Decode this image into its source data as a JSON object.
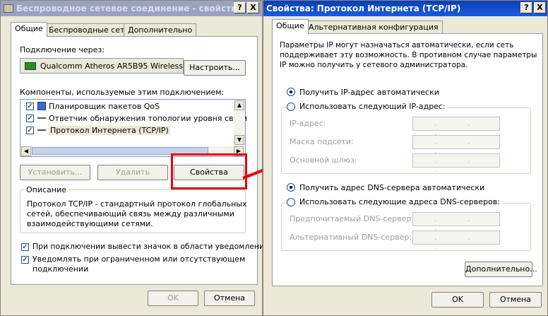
{
  "left_dialog": {
    "title": "Беспроводное сетевое соединение - свойства",
    "help_btn": "?",
    "close_btn": "X",
    "tabs": [
      "Общие",
      "Беспроводные сети",
      "Дополнительно"
    ],
    "connect_through_label": "Подключение через:",
    "adapter_name": "Qualcomm Atheros AR5B95 Wireless",
    "configure_btn": "Настроить...",
    "components_label": "Компоненты, используемые этим подключением:",
    "components": [
      {
        "label": "Планировщик пакетов QoS",
        "checked": true,
        "icon": "qos-icon"
      },
      {
        "label": "Ответчик обнаружения топологии уровня связи",
        "checked": true,
        "icon": "network-protocol-icon"
      },
      {
        "label": "Протокол Интернета (TCP/IP)",
        "checked": true,
        "icon": "network-protocol-icon"
      }
    ],
    "install_btn": "Установить...",
    "remove_btn": "Удалить",
    "properties_btn": "Свойства",
    "description_label": "Описание",
    "description_text_1": "Протокол TCP/IP - стандартный протокол глобальных",
    "description_text_2": "сетей, обеспечивающий связь между различными",
    "description_text_3": "взаимодействующими сетями.",
    "show_icon_label": "При подключении вывести значок в области уведомлений",
    "notify_label_1": "Уведомлять при ограниченном или отсутствующем",
    "notify_label_2": "подключении",
    "ok_btn": "OK",
    "cancel_btn": "Отмена",
    "highlight_color": "#e8000b"
  },
  "right_dialog": {
    "title": "Свойства: Протокол Интернета (TCP/IP)",
    "help_btn": "?",
    "close_btn": "X",
    "tabs": [
      "Общие",
      "Альтернативная конфигурация"
    ],
    "intro_1": "Параметры IP могут назначаться автоматически, если сеть",
    "intro_2": "поддерживает эту возможность. В противном случае параметры",
    "intro_3": "IP можно получить у сетевого администратора.",
    "auto_ip_label": "Получить IP-адрес автоматически",
    "manual_ip_label": "Использовать следующий IP-адрес:",
    "ip_address_label": "IP-адрес:",
    "subnet_label": "Маска подсети:",
    "gateway_label": "Основной шлюз:",
    "auto_dns_label": "Получить адрес DNS-сервера автоматически",
    "manual_dns_label": "Использовать следующие адреса DNS-серверов:",
    "preferred_dns_label": "Предпочитаемый DNS-сервер:",
    "alternate_dns_label": "Альтернативный DNS-сервер:",
    "advanced_btn": "Дополнительно...",
    "ok_btn": "OK",
    "cancel_btn": "Отмена",
    "ip_dots": ". . ."
  },
  "arrow_color": "#e8000b"
}
